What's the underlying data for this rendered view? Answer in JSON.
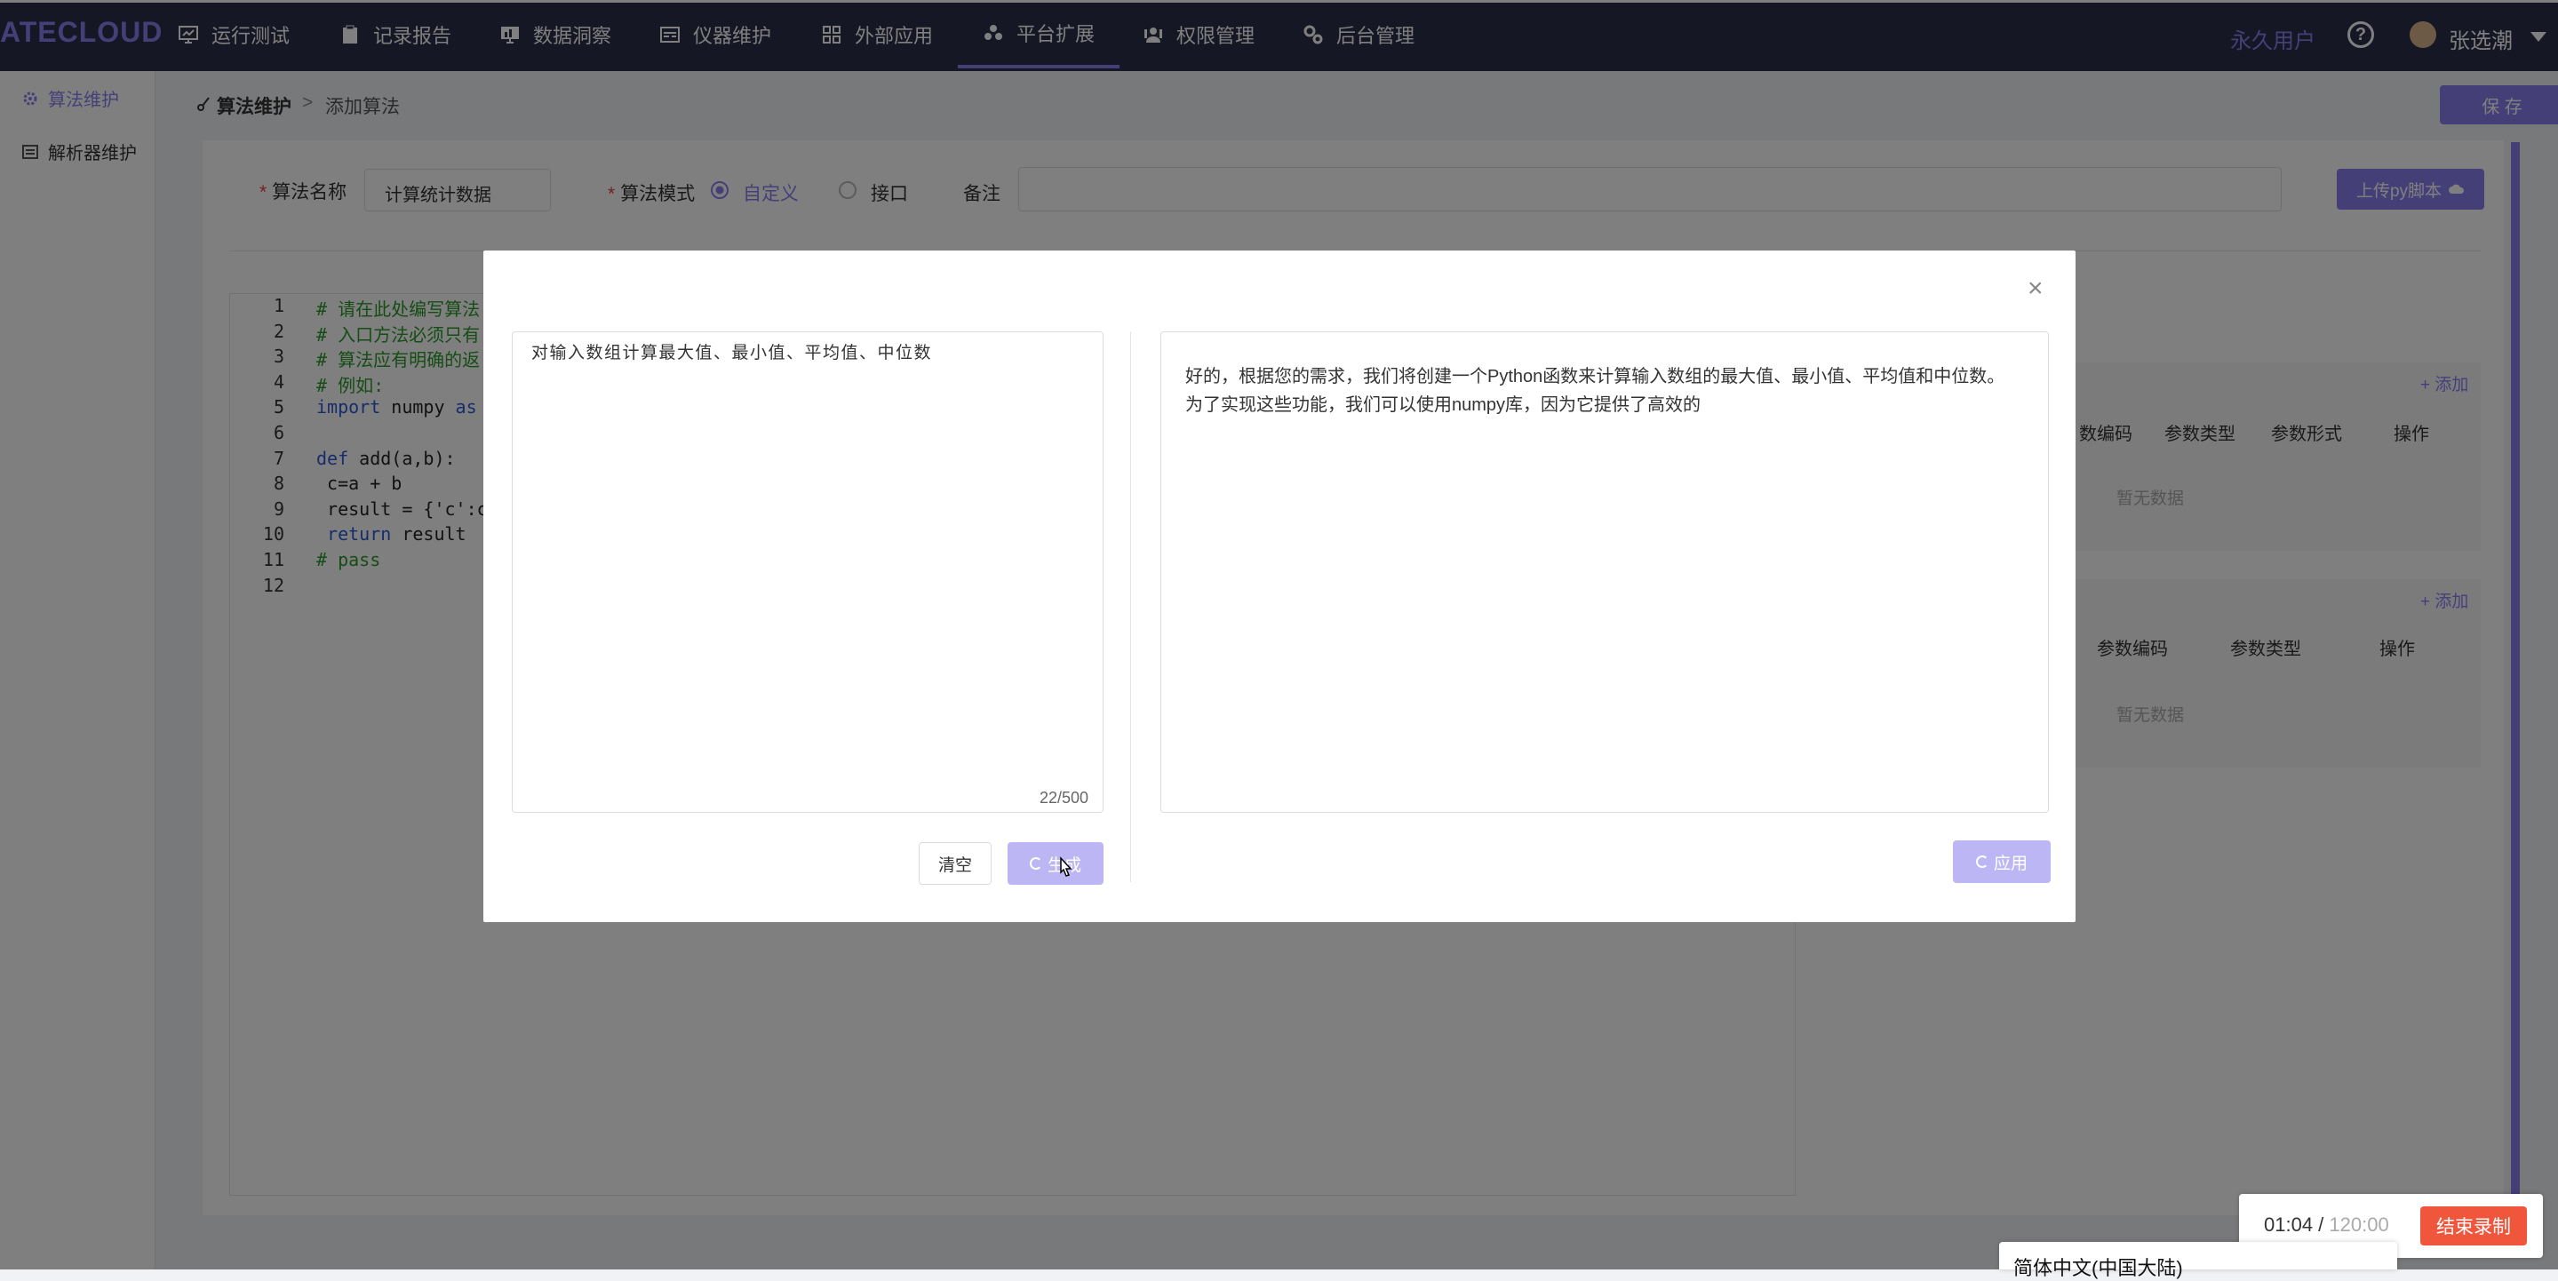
{
  "app": {
    "logo": "ATECLOUD"
  },
  "nav": {
    "items": [
      {
        "label": "运行测试",
        "icon": "monitor-icon"
      },
      {
        "label": "记录报告",
        "icon": "clipboard-icon"
      },
      {
        "label": "数据洞察",
        "icon": "chart-screen-icon"
      },
      {
        "label": "仪器维护",
        "icon": "instrument-icon"
      },
      {
        "label": "外部应用",
        "icon": "grid-icon"
      },
      {
        "label": "平台扩展",
        "icon": "cluster-icon",
        "active": true
      },
      {
        "label": "权限管理",
        "icon": "users-icon"
      },
      {
        "label": "后台管理",
        "icon": "gears-icon"
      }
    ],
    "perm_label": "永久用户",
    "help": "?",
    "username": "张选潮"
  },
  "sidebar": {
    "items": [
      {
        "label": "算法维护",
        "icon": "gear-icon",
        "active": true
      },
      {
        "label": "解析器维护",
        "icon": "parser-icon"
      }
    ]
  },
  "breadcrumb": {
    "parent": "算法维护",
    "sep": ">",
    "current": "添加算法"
  },
  "toolbar": {
    "save_label": "保 存"
  },
  "form": {
    "name_label": "算法名称",
    "name_value": "计算统计数据",
    "mode_label": "算法模式",
    "mode_custom": "自定义",
    "mode_interface": "接口",
    "remark_label": "备注",
    "upload_label": "上传py脚本"
  },
  "code": {
    "lines": [
      {
        "n": "1",
        "text": "# 请在此处编写算法",
        "cls": "cm"
      },
      {
        "n": "2",
        "text": "# 入口方法必须只有",
        "cls": "cm"
      },
      {
        "n": "3",
        "text": "# 算法应有明确的返",
        "cls": "cm"
      },
      {
        "n": "4",
        "text": "# 例如:",
        "cls": "cm"
      },
      {
        "n": "5",
        "text": "import numpy as",
        "cls": "mix"
      },
      {
        "n": "6",
        "text": "",
        "cls": "tx"
      },
      {
        "n": "7",
        "text": "def add(a,b):",
        "cls": "mix"
      },
      {
        "n": "8",
        "text": " c=a + b",
        "cls": "tx"
      },
      {
        "n": "9",
        "text": " result = {'c':c",
        "cls": "tx"
      },
      {
        "n": "10",
        "text": " return result",
        "cls": "mix"
      },
      {
        "n": "11",
        "text": "# pass",
        "cls": "cm"
      },
      {
        "n": "12",
        "text": "",
        "cls": "tx"
      }
    ]
  },
  "input_params": {
    "add_label": "+ 添加",
    "columns": [
      "数编码",
      "参数类型",
      "参数形式",
      "操作"
    ],
    "empty": "暂无数据"
  },
  "output_params": {
    "add_label": "+ 添加",
    "columns": [
      "参数编码",
      "参数类型",
      "操作"
    ],
    "empty": "暂无数据"
  },
  "dialog": {
    "close": "×",
    "prompt": "对输入数组计算最大值、最小值、平均值、中位数",
    "count": "22/500",
    "clear_label": "清空",
    "generate_label": "生成",
    "result": "好的，根据您的需求，我们将创建一个Python函数来计算输入数组的最大值、最小值、平均值和中位数。为了实现这些功能，我们可以使用numpy库，因为它提供了高效的",
    "apply_label": "应用"
  },
  "recorder": {
    "elapsed": "01:04",
    "sep": " / ",
    "total": "120:00",
    "stop_label": "结束录制"
  },
  "lang_popup": {
    "label": "简体中文(中国大陆)"
  },
  "colors": {
    "accent": "#8a7ff0",
    "nav_bg": "#2b2f4a",
    "stop": "#f0563c"
  }
}
